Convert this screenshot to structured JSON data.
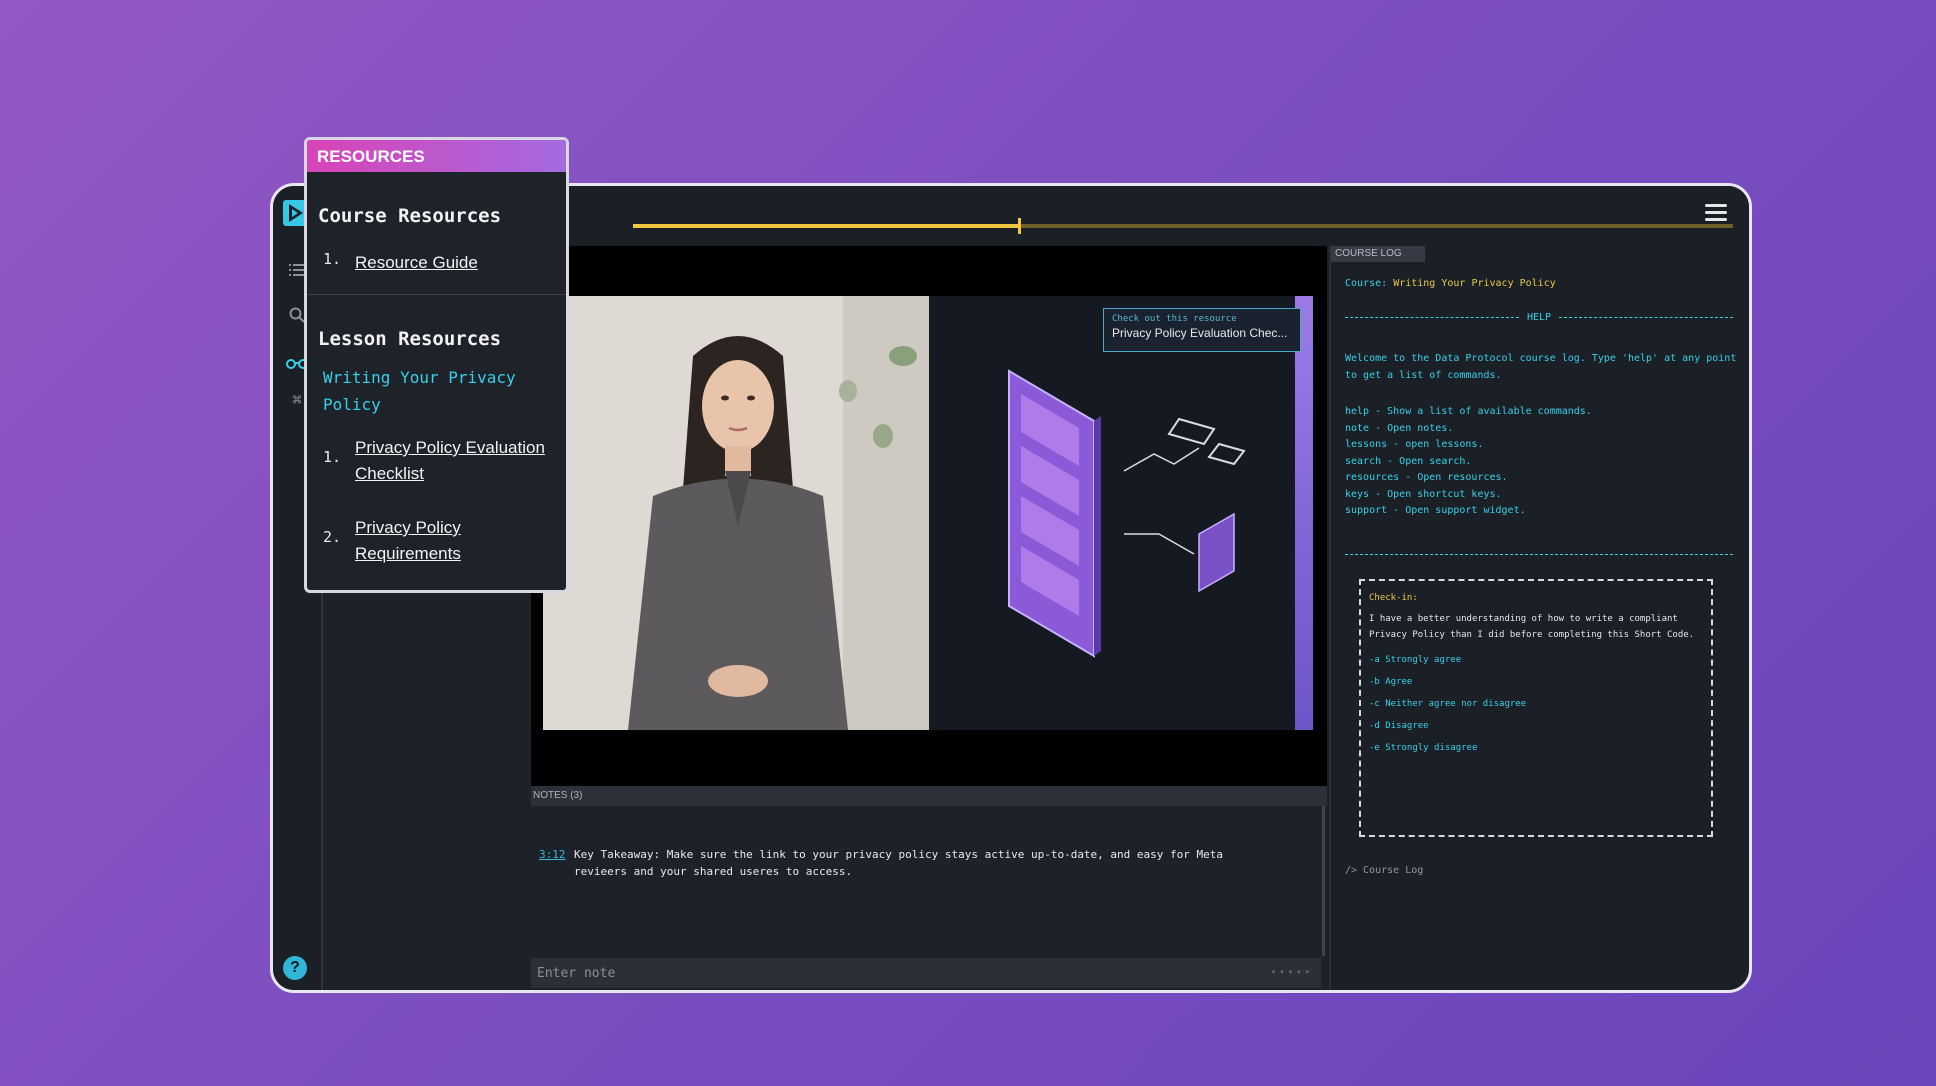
{
  "video": {
    "progress_pct": 35,
    "callout_small": "Check out this resource",
    "callout_main": "Privacy Policy Evaluation Chec..."
  },
  "notes": {
    "header": "NOTES (3)",
    "entry_time": "3:12",
    "entry_text": "Key Takeaway: Make sure the link to your privacy policy stays active  up-to-date, and easy for Meta revieers and your shared useres to access.",
    "input_placeholder": "Enter note"
  },
  "course_log": {
    "header": "COURSE LOG",
    "course_label": "Course:",
    "course_name": "Writing Your Privacy Policy",
    "help_title": "HELP",
    "welcome": "Welcome to the Data Protocol course log. Type 'help' at any point to get a list of commands.",
    "commands": [
      "help - Show a list of available commands.",
      "note - Open notes.",
      "lessons - open lessons.",
      "search - Open search.",
      "resources - Open resources.",
      "keys - Open shortcut keys.",
      "support - Open support widget."
    ],
    "checkin": {
      "title": "Check-in:",
      "question": "I have a better understanding of how to write a compliant Privacy Policy than I did before completing this Short Code.",
      "options": [
        "-a Strongly agree",
        "-b Agree",
        "-c Neither agree nor disagree",
        "-d Disagree",
        "-e Strongly disagree"
      ]
    },
    "prompt": "/> Course Log"
  },
  "resources": {
    "header": "RESOURCES",
    "course_title": "Course Resources",
    "course_items": [
      {
        "num": "1.",
        "label": "Resource Guide"
      }
    ],
    "lesson_title": "Lesson Resources",
    "lesson_name": "Writing Your Privacy Policy",
    "lesson_items": [
      {
        "num": "1.",
        "label": "Privacy Policy Evaluation Checklist"
      },
      {
        "num": "2.",
        "label": "Privacy Policy Requirements"
      }
    ]
  },
  "rail": {
    "help_label": "?"
  },
  "colors": {
    "accent_cyan": "#38d0e8",
    "accent_yellow": "#e9c845",
    "resources_header": "#d944b8"
  }
}
